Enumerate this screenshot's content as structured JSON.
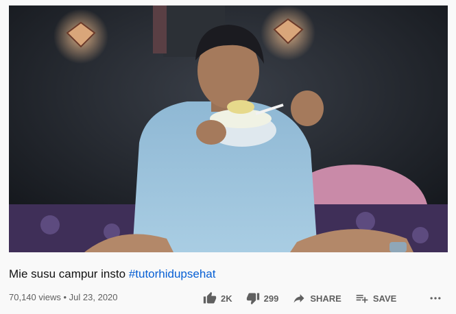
{
  "video": {
    "title_main": "Mie susu campur insto",
    "hashtag": "#tutorhidupsehat",
    "views": "70,140 views",
    "separator": " • ",
    "date": "Jul 23, 2020"
  },
  "actions": {
    "like_count": "2K",
    "dislike_count": "299",
    "share_label": "SHARE",
    "save_label": "SAVE"
  },
  "colors": {
    "hashtag": "#065fd4",
    "meta": "#606060",
    "background": "#f9f9f9"
  }
}
